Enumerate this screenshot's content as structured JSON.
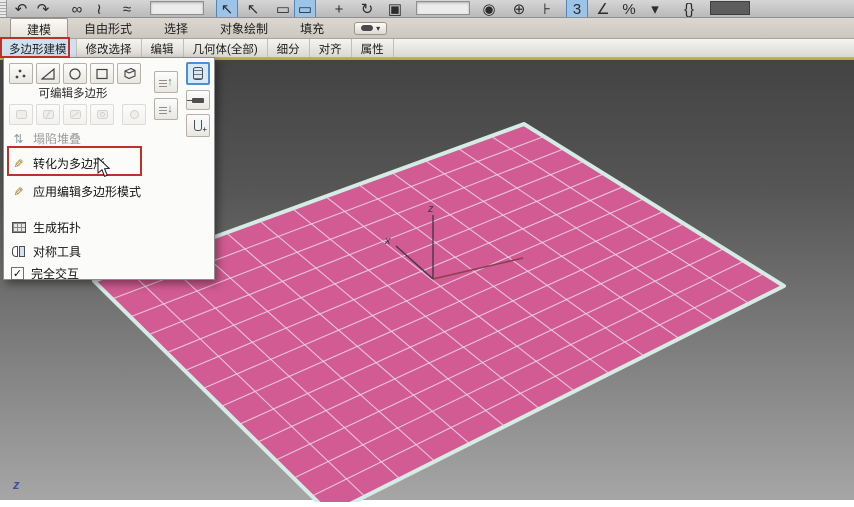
{
  "toolbar": {
    "icons": [
      {
        "name": "undo-icon",
        "glyph": "↶"
      },
      {
        "name": "redo-icon",
        "glyph": "↷"
      },
      {
        "name": "select-and-link-icon",
        "glyph": "∞",
        "gap": 12
      },
      {
        "name": "unlink-selection-icon",
        "glyph": "≀"
      },
      {
        "name": "bind-to-space-warp-icon",
        "glyph": "≈",
        "gap": 6
      },
      {
        "name": "selection-filter-dropdown",
        "glyph": "",
        "variant": "box-light",
        "gap": 12
      },
      {
        "name": "select-object-icon",
        "glyph": "↖",
        "variant": "hl",
        "gap": 12
      },
      {
        "name": "select-by-name-icon",
        "glyph": "↖",
        "gap": 4
      },
      {
        "name": "rectangular-selection-region-icon",
        "glyph": "▭",
        "gap": 8
      },
      {
        "name": "window-crossing-icon",
        "glyph": "▭",
        "variant": "hl"
      },
      {
        "name": "select-and-move-icon",
        "glyph": "+",
        "gap": 12
      },
      {
        "name": "select-and-rotate-icon",
        "glyph": "↻",
        "gap": 6
      },
      {
        "name": "select-and-scale-icon",
        "glyph": "▣",
        "gap": 6
      },
      {
        "name": "reference-coordinate-dropdown",
        "glyph": "",
        "variant": "box-light",
        "gap": 10
      },
      {
        "name": "use-pivot-point-center-icon",
        "glyph": "◉",
        "gap": 8
      },
      {
        "name": "select-and-manipulate-icon",
        "glyph": "⊕",
        "gap": 8
      },
      {
        "name": "keyboard-shortcut-override-icon",
        "glyph": "⊦",
        "gap": 6
      },
      {
        "name": "snaps-toggle-icon",
        "glyph": "3",
        "variant": "hl",
        "gap": 8
      },
      {
        "name": "angle-snap-icon",
        "glyph": "∠",
        "gap": 4
      },
      {
        "name": "percent-snap-icon",
        "glyph": "%",
        "gap": 4
      },
      {
        "name": "spinner-snap-icon",
        "glyph": "▾",
        "gap": 4
      },
      {
        "name": "named-selection-sets-icon",
        "glyph": "{}",
        "gap": 12
      },
      {
        "name": "mirror-dropdown",
        "glyph": "",
        "variant": "box-dark",
        "gap": 10
      }
    ]
  },
  "ribbon": {
    "tabs": [
      {
        "label": "建模",
        "active": true
      },
      {
        "label": "自由形式",
        "active": false
      },
      {
        "label": "选择",
        "active": false
      },
      {
        "label": "对象绘制",
        "active": false
      },
      {
        "label": "填充",
        "active": false
      }
    ],
    "panels": [
      "多边形建模",
      "修改选择",
      "编辑",
      "几何体(全部)",
      "细分",
      "对齐",
      "属性"
    ]
  },
  "flyout": {
    "editable_poly_label": "可编辑多边形",
    "subobject_buttons": [
      "vertex",
      "edge",
      "border",
      "polygon",
      "element"
    ],
    "items": [
      {
        "label": "塌陷堆叠",
        "state": "disabled"
      },
      {
        "label": "转化为多边形",
        "state": "highlighted"
      },
      {
        "label": "应用编辑多边形模式",
        "state": "normal"
      },
      {
        "label": "生成拓扑",
        "state": "normal"
      },
      {
        "label": "对称工具",
        "state": "normal"
      },
      {
        "label": "完全交互",
        "state": "checked"
      }
    ],
    "checkbox_glyph": "✓"
  },
  "viewport": {
    "axis": {
      "tripod_z": "z",
      "tripod_x": "x",
      "corner_z": "z"
    },
    "grid_divisions": 13,
    "colors": {
      "plane": "#d15b92",
      "grid": "#ecd7e6",
      "selection_edge": "#d5ece5",
      "tripod": "#3d3644",
      "tripod_y": "#8a4150",
      "active_border": "#b9a94b"
    }
  },
  "annotations": {
    "box_color": "#c03028"
  }
}
